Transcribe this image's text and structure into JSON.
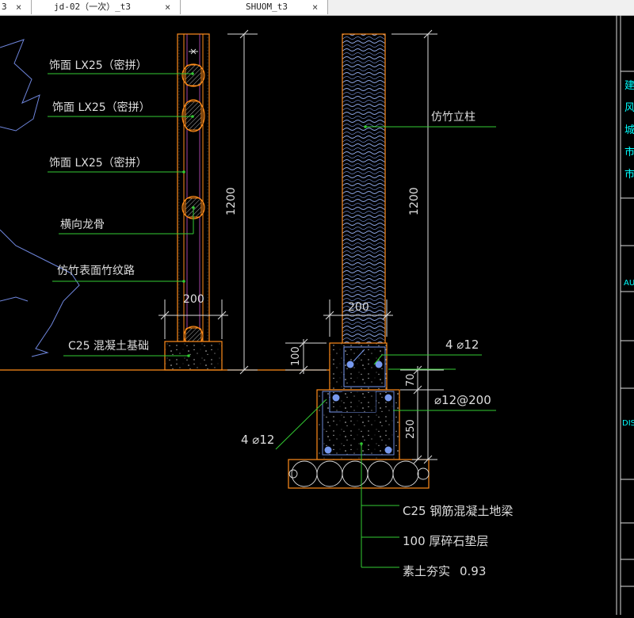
{
  "tabs": [
    {
      "label": "3",
      "close": "×"
    },
    {
      "label": "jd-02（一次）_t3",
      "close": "×"
    },
    {
      "label": "SHUOM_t3",
      "close": "×"
    }
  ],
  "drawing": {
    "labels": {
      "finish_1": "饰面  LX25（密拼）",
      "finish_2": "饰面  LX25（密拼）",
      "finish_3": "饰面  LX25（密拼）",
      "keel": "横向龙骨",
      "bamboo_texture": "仿竹表面竹纹路",
      "c25_base": "C25 混凝土基础",
      "column": "仿竹立柱",
      "rebar_top": "4 ⌀12",
      "stirrup": "⌀12@200",
      "rebar_bottom": "4 ⌀12",
      "ground_beam": "C25 钢筋混凝土地梁",
      "gravel": "100  厚碎石垫层",
      "soil": "素土夯实",
      "compaction": "0.93"
    },
    "dims": {
      "left_height": "1200",
      "right_height": "1200",
      "left_width": "200",
      "right_width": "200",
      "d100": "100",
      "d70": "70",
      "d250": "250"
    },
    "title_block": {
      "chars": [
        "建",
        "风",
        "城",
        "市",
        "市"
      ],
      "au": "AU",
      "dis": "DIS"
    }
  },
  "colors": {
    "background": "#000000",
    "leader": "#33cc33",
    "outline": "#ff8c1a",
    "rebar": "#7799ee",
    "dimension": "#dddddd",
    "bamboo": "#8fa8e8",
    "title_text": "#00ffff"
  }
}
